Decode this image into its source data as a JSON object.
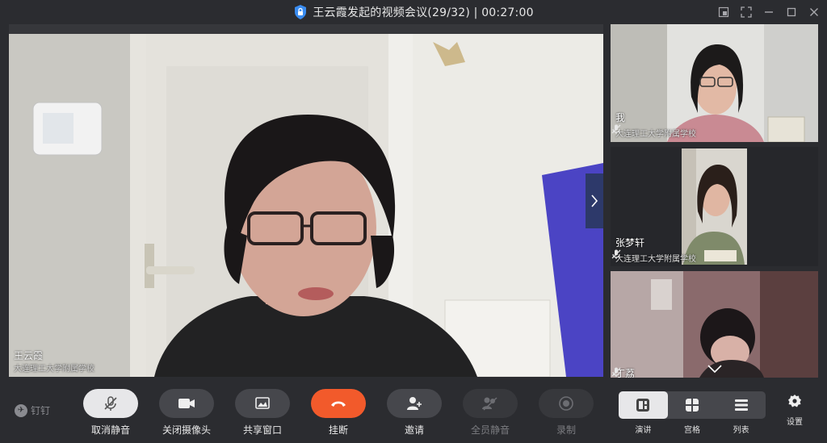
{
  "window": {
    "title": "王云霞发起的视频会议(29/32) | 00:27:00"
  },
  "main_video": {
    "name": "王云霞",
    "org": "大连理工大学附属学校"
  },
  "tiles": [
    {
      "name": "我",
      "org": "大连理工大学附属学校"
    },
    {
      "name": "张梦轩",
      "org": "大连理工大学附属学校"
    },
    {
      "name": "丁荔",
      "org": ""
    }
  ],
  "toolbar": {
    "brand": "钉钉",
    "buttons": [
      {
        "label": "取消静音",
        "icon": "mic-muted-icon"
      },
      {
        "label": "关闭摄像头",
        "icon": "camera-icon"
      },
      {
        "label": "共享窗口",
        "icon": "share-screen-icon"
      },
      {
        "label": "挂断",
        "icon": "hangup-icon"
      },
      {
        "label": "邀请",
        "icon": "add-user-icon"
      },
      {
        "label": "全员静音",
        "icon": "mute-all-icon"
      },
      {
        "label": "录制",
        "icon": "record-icon"
      }
    ],
    "layouts": [
      {
        "label": "演讲",
        "icon": "speaker-layout-icon",
        "active": true
      },
      {
        "label": "宫格",
        "icon": "grid-layout-icon",
        "active": false
      },
      {
        "label": "列表",
        "icon": "list-layout-icon",
        "active": false
      }
    ],
    "settings_label": "设置"
  },
  "colors": {
    "background": "#2b2c30",
    "hangup": "#f25a2b",
    "button": "#46474c",
    "active_button": "#e7e7e9"
  }
}
